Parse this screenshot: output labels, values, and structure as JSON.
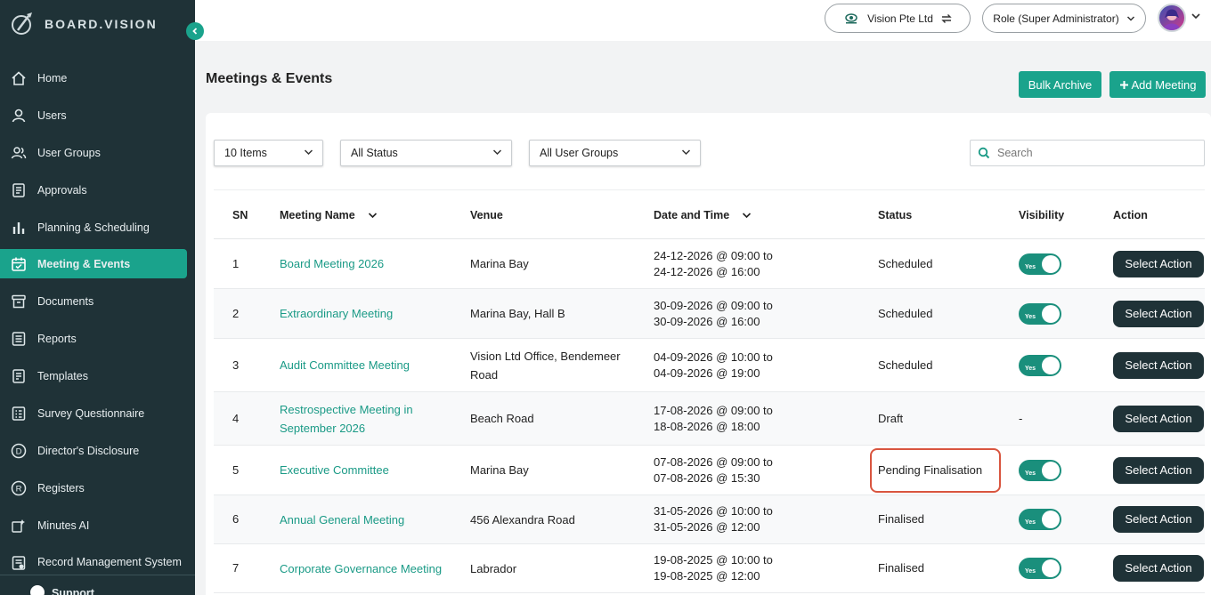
{
  "brand": {
    "name": "BOARD.VISION"
  },
  "sidebar": {
    "items": [
      {
        "label": "Home",
        "icon": "home-icon"
      },
      {
        "label": "Users",
        "icon": "user-icon"
      },
      {
        "label": "User Groups",
        "icon": "users-icon"
      },
      {
        "label": "Approvals",
        "icon": "approvals-icon"
      },
      {
        "label": "Planning & Scheduling",
        "icon": "bar-chart-icon"
      },
      {
        "label": "Meeting & Events",
        "icon": "calendar-icon",
        "active": true
      },
      {
        "label": "Documents",
        "icon": "archive-box-icon"
      },
      {
        "label": "Reports",
        "icon": "report-icon"
      },
      {
        "label": "Templates",
        "icon": "template-icon"
      },
      {
        "label": "Survey Questionnaire",
        "icon": "survey-icon"
      },
      {
        "label": "Director's Disclosure",
        "icon": "d-circle-icon"
      },
      {
        "label": "Registers",
        "icon": "r-circle-icon"
      },
      {
        "label": "Minutes AI",
        "icon": "minutes-ai-icon"
      },
      {
        "label": "Record Management System",
        "icon": "record-icon"
      }
    ],
    "support_label": "Support"
  },
  "header": {
    "org_label": "Vision Pte Ltd",
    "role_label": "Role (Super Administrator)"
  },
  "page": {
    "title": "Meetings & Events",
    "bulk_archive_label": "Bulk Archive",
    "add_meeting_label": "Add Meeting"
  },
  "filters": {
    "items_per_page": "10 Items",
    "status": "All Status",
    "user_groups": "All User Groups",
    "search_placeholder": "Search"
  },
  "table": {
    "headers": {
      "sn": "SN",
      "name": "Meeting Name",
      "venue": "Venue",
      "datetime": "Date and Time",
      "status": "Status",
      "visibility": "Visibility",
      "action": "Action"
    },
    "toggle_label": "Yes",
    "action_label": "Select Action",
    "rows": [
      {
        "sn": "1",
        "name": "Board Meeting 2026",
        "venue": "Marina Bay",
        "start": "24-12-2026 @ 09:00 to",
        "end": "24-12-2026 @ 16:00",
        "status": "Scheduled",
        "visible": true
      },
      {
        "sn": "2",
        "name": "Extraordinary Meeting",
        "venue": "Marina Bay, Hall B",
        "start": "30-09-2026 @ 09:00 to",
        "end": "30-09-2026 @ 16:00",
        "status": "Scheduled",
        "visible": true
      },
      {
        "sn": "3",
        "name": "Audit Committee Meeting",
        "venue": "Vision Ltd Office, Bendemeer Road",
        "start": "04-09-2026 @ 10:00 to",
        "end": "04-09-2026 @ 19:00",
        "status": "Scheduled",
        "visible": true
      },
      {
        "sn": "4",
        "name": "Restrospective Meeting in September 2026",
        "venue": "Beach Road",
        "start": "17-08-2026 @ 09:00 to",
        "end": "18-08-2026 @ 18:00",
        "status": "Draft",
        "visible": false,
        "visibility_text": "-"
      },
      {
        "sn": "5",
        "name": "Executive Committee",
        "venue": "Marina Bay",
        "start": "07-08-2026 @ 09:00 to",
        "end": "07-08-2026 @ 15:30",
        "status": "Pending Finalisation",
        "visible": true,
        "highlighted": true
      },
      {
        "sn": "6",
        "name": "Annual General Meeting",
        "venue": "456 Alexandra Road",
        "start": "31-05-2026 @ 10:00 to",
        "end": "31-05-2026 @ 12:00",
        "status": "Finalised",
        "visible": true
      },
      {
        "sn": "7",
        "name": "Corporate Governance Meeting",
        "venue": "Labrador",
        "start": "19-08-2025 @ 10:00 to",
        "end": "19-08-2025 @ 12:00",
        "status": "Finalised",
        "visible": true
      }
    ]
  },
  "colors": {
    "sidebar_bg": "#1f3237",
    "accent": "#1aa38c",
    "link": "#1a9a86",
    "highlight_border": "#d9553f"
  }
}
